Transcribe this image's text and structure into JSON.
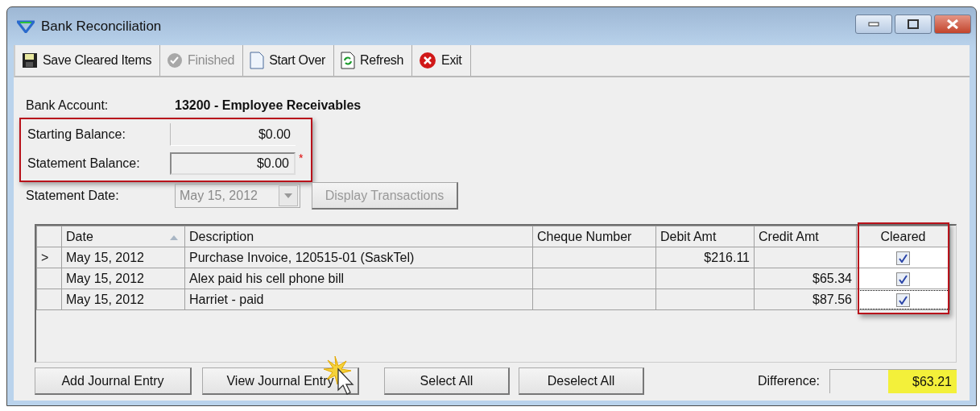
{
  "window": {
    "title": "Bank Reconciliation"
  },
  "toolbar": [
    {
      "kind": "save",
      "label": "Save Cleared Items",
      "disabled": false
    },
    {
      "kind": "finished",
      "label": "Finished",
      "disabled": true
    },
    {
      "kind": "new",
      "label": "Start Over",
      "disabled": false
    },
    {
      "kind": "refresh",
      "label": "Refresh",
      "disabled": false
    },
    {
      "kind": "exit",
      "label": "Exit",
      "disabled": false
    }
  ],
  "bank_account": {
    "label": "Bank Account:",
    "value": "13200 - Employee Receivables"
  },
  "balances": {
    "highlighted": true,
    "fields": [
      {
        "label": "Starting Balance:",
        "value": "$0.00",
        "editable": false
      },
      {
        "label": "Statement Balance:",
        "value": "$0.00",
        "editable": true,
        "required_mark": "*"
      }
    ]
  },
  "statement_date": {
    "label": "Statement Date:",
    "value": "May 15, 2012",
    "disabled": true
  },
  "display_button": {
    "label": "Display Transactions",
    "disabled": true
  },
  "table": {
    "columns": [
      {
        "label": "Date",
        "sorted": true
      },
      {
        "label": "Description",
        "sorted": false
      },
      {
        "label": "Cheque Number",
        "sorted": false
      },
      {
        "label": "Debit Amt",
        "sorted": false
      },
      {
        "label": "Credit Amt",
        "sorted": false
      },
      {
        "label": "Cleared",
        "sorted": false
      }
    ],
    "cleared_highlighted": true,
    "rows": [
      {
        "marker": ">",
        "date": "May 15, 2012",
        "description": "Purchase Invoice, 120515-01 (SaskTel)",
        "cheque": "",
        "debit": "$216.11",
        "credit": "",
        "cleared": true,
        "focused": false
      },
      {
        "date": "May 15, 2012",
        "description": "Alex paid his cell phone bill",
        "cheque": "",
        "debit": "",
        "credit": "$65.34",
        "cleared": true,
        "focused": false
      },
      {
        "date": "May 15, 2012",
        "description": "Harriet - paid",
        "cheque": "",
        "debit": "",
        "credit": "$87.56",
        "cleared": true,
        "focused": true
      }
    ]
  },
  "buttons": [
    {
      "label": "Add Journal Entry",
      "hovered": false
    },
    {
      "label": "View Journal Entry",
      "hovered": true
    },
    {
      "label": "Select All",
      "hovered": false
    },
    {
      "label": "Deselect All",
      "hovered": false
    }
  ],
  "difference": {
    "label": "Difference:",
    "value": "$63.21",
    "highlighted": true
  }
}
